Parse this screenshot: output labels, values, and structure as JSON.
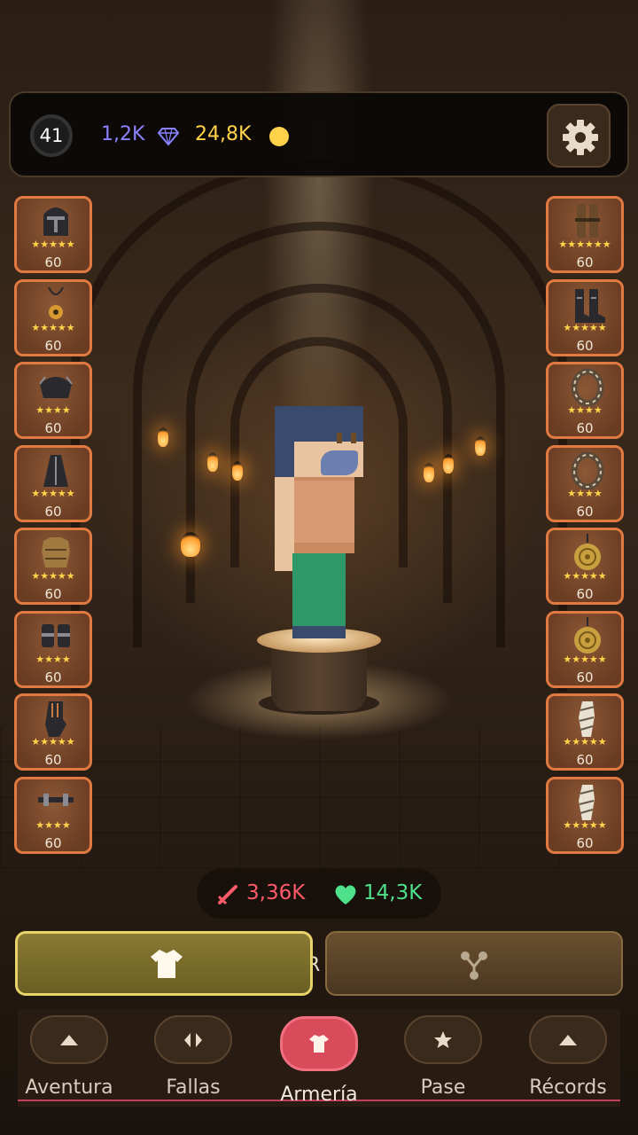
{
  "header": {
    "level": "41",
    "gems": "1,2K",
    "coins": "24,8K",
    "gem_icon": "diamond-icon",
    "coin_icon": "coin-icon",
    "settings_icon": "gear-icon"
  },
  "left_slots": [
    {
      "icon": "helmet-icon",
      "stars": "★★★★★",
      "level": "60"
    },
    {
      "icon": "amulet-icon",
      "stars": "★★★★★",
      "level": "60"
    },
    {
      "icon": "pauldron-icon",
      "stars": "★★★★",
      "level": "60"
    },
    {
      "icon": "cloak-icon",
      "stars": "★★★★★",
      "level": "60"
    },
    {
      "icon": "chest-armor-icon",
      "stars": "★★★★★",
      "level": "60"
    },
    {
      "icon": "bracers-icon",
      "stars": "★★★★",
      "level": "60"
    },
    {
      "icon": "gauntlet-icon",
      "stars": "★★★★★",
      "level": "60"
    },
    {
      "icon": "crossbow-icon",
      "stars": "★★★★",
      "level": "60"
    }
  ],
  "right_slots": [
    {
      "icon": "leg-armor-icon",
      "stars": "★★★★★★",
      "level": "60"
    },
    {
      "icon": "boots-icon",
      "stars": "★★★★★",
      "level": "60"
    },
    {
      "icon": "ring-icon",
      "stars": "★★★★",
      "level": "60"
    },
    {
      "icon": "ring-icon",
      "stars": "★★★★",
      "level": "60"
    },
    {
      "icon": "medallion-icon",
      "stars": "★★★★★",
      "level": "60"
    },
    {
      "icon": "medallion-icon",
      "stars": "★★★★★",
      "level": "60"
    },
    {
      "icon": "bandage-wrap-icon",
      "stars": "★★★★★",
      "level": "60"
    },
    {
      "icon": "bandage-wrap-icon",
      "stars": "★★★★★",
      "level": "60"
    }
  ],
  "stats": {
    "attack": "3,36K",
    "health": "14,3K",
    "attack_color": "#ff5a6a",
    "health_color": "#4ee08a"
  },
  "tabs": {
    "armor_icon": "shirt-icon",
    "skills_icon": "skill-tree-icon",
    "hidden_text": "R"
  },
  "nav": [
    {
      "label": "Aventura",
      "icon": "triangle-icon"
    },
    {
      "label": "Fallas",
      "icon": "diamond-arrows-icon"
    },
    {
      "label": "Armería",
      "icon": "shirt-icon",
      "active": true
    },
    {
      "label": "Pase",
      "icon": "star-icon"
    },
    {
      "label": "Récords",
      "icon": "triangle-icon"
    }
  ]
}
